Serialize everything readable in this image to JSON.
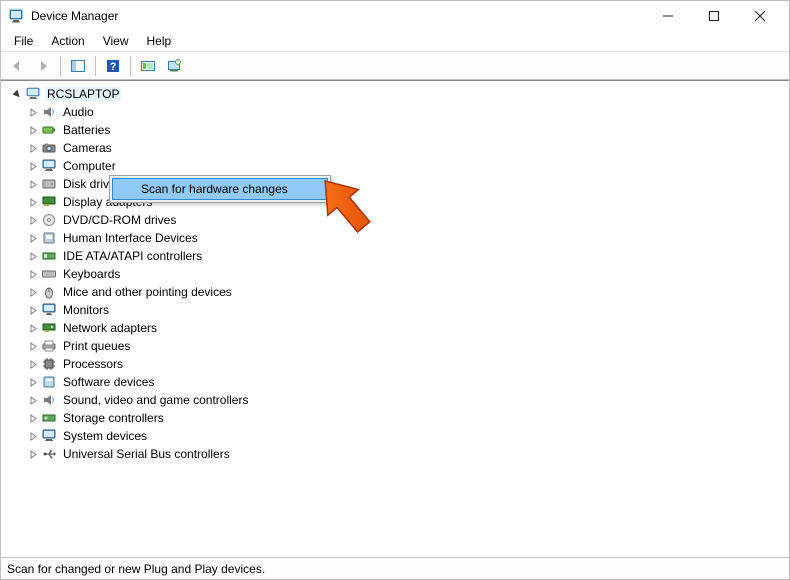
{
  "titlebar": {
    "title": "Device Manager"
  },
  "menubar": {
    "file": "File",
    "action": "Action",
    "view": "View",
    "help": "Help"
  },
  "tree": {
    "root": "RCSLAPTOP",
    "nodes": [
      {
        "label": "Audio"
      },
      {
        "label": "Batteries"
      },
      {
        "label": "Cameras"
      },
      {
        "label": "Computer"
      },
      {
        "label": "Disk drives"
      },
      {
        "label": "Display adapters"
      },
      {
        "label": "DVD/CD-ROM drives"
      },
      {
        "label": "Human Interface Devices"
      },
      {
        "label": "IDE ATA/ATAPI controllers"
      },
      {
        "label": "Keyboards"
      },
      {
        "label": "Mice and other pointing devices"
      },
      {
        "label": "Monitors"
      },
      {
        "label": "Network adapters"
      },
      {
        "label": "Print queues"
      },
      {
        "label": "Processors"
      },
      {
        "label": "Software devices"
      },
      {
        "label": "Sound, video and game controllers"
      },
      {
        "label": "Storage controllers"
      },
      {
        "label": "System devices"
      },
      {
        "label": "Universal Serial Bus controllers"
      }
    ]
  },
  "context_menu": {
    "scan": "Scan for hardware changes"
  },
  "statusbar": {
    "text": "Scan for changed or new Plug and Play devices."
  }
}
